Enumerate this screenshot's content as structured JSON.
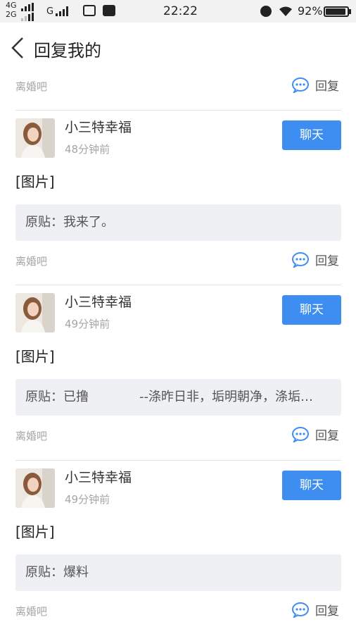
{
  "status_bar": {
    "net_top": "4G",
    "net_bottom": "2G",
    "carrier_g": "G",
    "time": "22:22",
    "battery": "92%"
  },
  "header": {
    "title": "回复我的"
  },
  "colors": {
    "accent": "#3d8ef0",
    "quote_bg": "#eef0f3",
    "muted_text": "#a5a5a5"
  },
  "items": [
    {
      "bar_name": "离婚吧",
      "reply_label": "回复"
    },
    {
      "user": "小三特幸福",
      "time": "48分钟前",
      "chat_label": "聊天",
      "content": "[图片]",
      "quote": "原贴：我来了。",
      "bar_name": "离婚吧",
      "reply_label": "回复"
    },
    {
      "user": "小三特幸福",
      "time": "49分钟前",
      "chat_label": "聊天",
      "content": "[图片]",
      "quote": "原贴：已撸　　　　--涤昨日非，垢明朝净，涤垢…",
      "bar_name": "离婚吧",
      "reply_label": "回复"
    },
    {
      "user": "小三特幸福",
      "time": "49分钟前",
      "chat_label": "聊天",
      "content": "[图片]",
      "quote": "原贴：爆料",
      "bar_name": "离婚吧",
      "reply_label": "回复"
    }
  ]
}
